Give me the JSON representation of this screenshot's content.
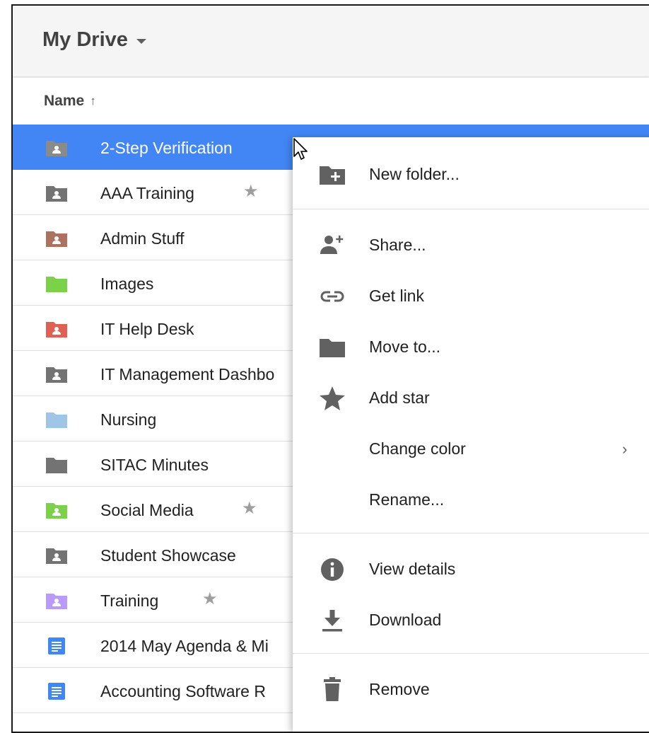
{
  "header": {
    "title": "My Drive"
  },
  "columns": {
    "name_label": "Name",
    "sort_indicator": "↑"
  },
  "files": [
    {
      "name": "2-Step Verification",
      "type": "shared-folder",
      "color": "#8a8a8a",
      "starred": false,
      "selected": true
    },
    {
      "name": "AAA Training",
      "type": "shared-folder",
      "color": "#737373",
      "starred": true,
      "selected": false
    },
    {
      "name": "Admin Stuff",
      "type": "shared-folder",
      "color": "#ac725e",
      "starred": false,
      "selected": false
    },
    {
      "name": "Images",
      "type": "folder",
      "color": "#7bd148",
      "starred": false,
      "selected": false
    },
    {
      "name": "IT Help Desk",
      "type": "shared-folder",
      "color": "#e06055",
      "starred": false,
      "selected": false
    },
    {
      "name": "IT Management Dashbo",
      "type": "shared-folder",
      "color": "#737373",
      "starred": false,
      "selected": false
    },
    {
      "name": "Nursing",
      "type": "folder",
      "color": "#9fc6e7",
      "starred": false,
      "selected": false
    },
    {
      "name": "SITAC Minutes",
      "type": "folder",
      "color": "#737373",
      "starred": false,
      "selected": false
    },
    {
      "name": "Social Media",
      "type": "shared-folder",
      "color": "#7bd148",
      "starred": true,
      "selected": false
    },
    {
      "name": "Student Showcase",
      "type": "shared-folder",
      "color": "#737373",
      "starred": false,
      "selected": false
    },
    {
      "name": "Training",
      "type": "shared-folder",
      "color": "#b99aff",
      "starred": true,
      "selected": false
    },
    {
      "name": "2014 May Agenda & Mi",
      "type": "doc",
      "color": "#4285f4",
      "starred": false,
      "selected": false
    },
    {
      "name": "Accounting Software R",
      "type": "doc",
      "color": "#4285f4",
      "starred": false,
      "selected": false
    }
  ],
  "context_menu": {
    "new_folder": "New folder...",
    "share": "Share...",
    "get_link": "Get link",
    "move_to": "Move to...",
    "add_star": "Add star",
    "change_color": "Change color",
    "change_color_chevron": "›",
    "rename": "Rename...",
    "view_details": "View details",
    "download": "Download",
    "remove": "Remove"
  },
  "icons": {
    "star_glyph": "★",
    "menu_icon_color": "#616161",
    "accent": "#4285f4"
  }
}
